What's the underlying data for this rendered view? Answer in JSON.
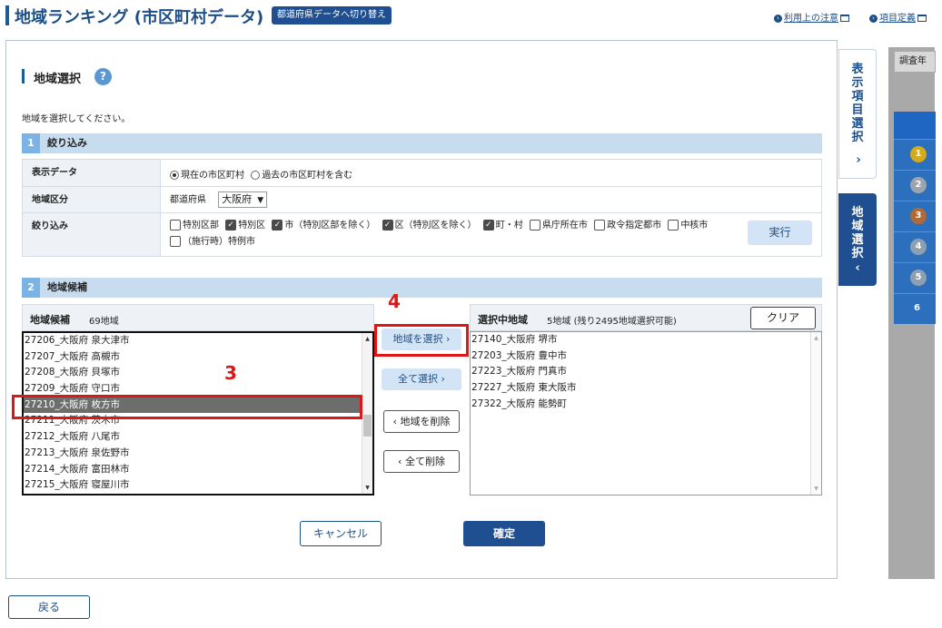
{
  "header": {
    "title": "地域ランキング (市区町村データ)",
    "switch_button": "都道府県データへ切り替え",
    "links": [
      "利用上の注意",
      "項目定義"
    ]
  },
  "section": {
    "title": "地域選択",
    "instruction": "地域を選択してください。"
  },
  "step1": {
    "number": "1",
    "label": "絞り込み",
    "display_data": {
      "label": "表示データ",
      "options": [
        {
          "label": "現在の市区町村",
          "selected": true
        },
        {
          "label": "過去の市区町村を含む",
          "selected": false
        }
      ]
    },
    "region_type": {
      "label": "地域区分",
      "prefecture_label": "都道府県",
      "prefecture_value": "大阪府"
    },
    "filter": {
      "label": "絞り込み",
      "options": [
        {
          "label": "特別区部",
          "checked": false
        },
        {
          "label": "特別区",
          "checked": true
        },
        {
          "label": "市（特別区部を除く）",
          "checked": true
        },
        {
          "label": "区（特別区を除く）",
          "checked": true
        },
        {
          "label": "町・村",
          "checked": true
        },
        {
          "label": "県庁所在市",
          "checked": false
        },
        {
          "label": "政令指定都市",
          "checked": false
        },
        {
          "label": "中核市",
          "checked": false
        },
        {
          "label": "（施行時）特例市",
          "checked": false
        }
      ],
      "execute_button": "実行"
    }
  },
  "step2": {
    "number": "2",
    "label": "地域候補",
    "candidates": {
      "title": "地域候補",
      "count": "69地域",
      "items": [
        "27206_大阪府 泉大津市",
        "27207_大阪府 高槻市",
        "27208_大阪府 貝塚市",
        "27209_大阪府 守口市",
        "27210_大阪府 枚方市",
        "27211_大阪府 茨木市",
        "27212_大阪府 八尾市",
        "27213_大阪府 泉佐野市",
        "27214_大阪府 富田林市",
        "27215_大阪府 寝屋川市"
      ],
      "selected_index": 4
    },
    "buttons": {
      "select": "地域を選択",
      "select_all": "全て選択",
      "remove": "地域を削除",
      "remove_all": "全て削除"
    },
    "selected": {
      "title": "選択中地域",
      "count": "5地域",
      "remaining": "(残り2495地域選択可能)",
      "clear_button": "クリア",
      "items": [
        "27140_大阪府 堺市",
        "27203_大阪府 豊中市",
        "27223_大阪府 門真市",
        "27227_大阪府 東大阪市",
        "27322_大阪府 能勢町"
      ]
    }
  },
  "footer_buttons": {
    "cancel": "キャンセル",
    "confirm": "確定",
    "back": "戻る"
  },
  "annotations": {
    "step3": "3",
    "step4": "4"
  },
  "side_tabs": {
    "display_items": "表示項目選択",
    "region_select": "地域選択"
  },
  "ranking_panel": {
    "header": "調査年",
    "ranks": [
      "1",
      "2",
      "3",
      "4",
      "5",
      "6"
    ]
  },
  "colors": {
    "brand_blue": "#1f4f91",
    "highlight_red": "#e01515",
    "light_blue": "#d3e4f6"
  }
}
